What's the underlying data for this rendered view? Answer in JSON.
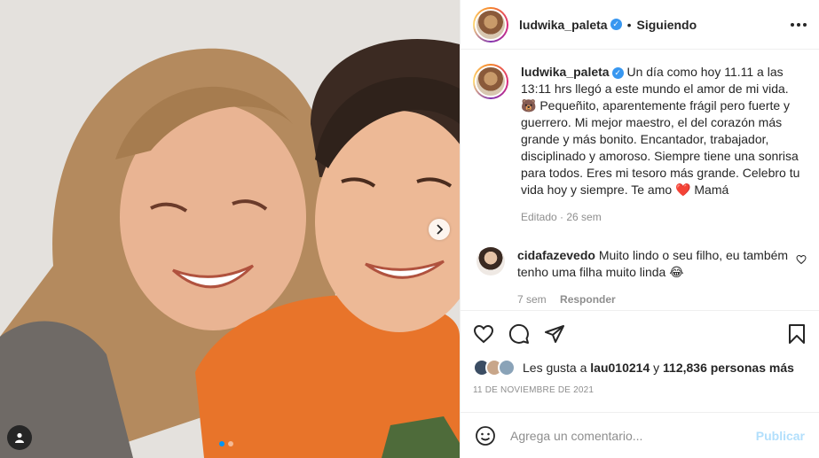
{
  "post": {
    "username": "ludwika_paleta",
    "following_label": "Siguiendo",
    "separator": "•"
  },
  "caption": {
    "username": "ludwika_paleta",
    "text": "Un día como hoy 11.11 a las 13:11 hrs llegó a este mundo el amor de mi vida. 🐻 Pequeñito, aparentemente frágil pero fuerte y guerrero. Mi mejor maestro, el del corazón más grande y más bonito. Encantador, trabajador, disciplinado y amoroso. Siempre tiene una sonrisa para todos. Eres mi tesoro más grande. Celebro tu vida hoy y siempre. Te amo ❤️ Mamá",
    "meta": "Editado · 26 sem"
  },
  "comment": {
    "username": "cidafazevedo",
    "text": "Muito lindo o seu filho, eu também tenho uma filha muito linda 😂",
    "time": "7 sem",
    "reply_label": "Responder"
  },
  "likes": {
    "prefix": "Les gusta a",
    "user": "lau010214",
    "joiner": "y",
    "count_text": "112,836 personas más"
  },
  "date": "11 de noviembre de 2021",
  "add_comment": {
    "placeholder": "Agrega un comentario...",
    "publish_label": "Publicar"
  },
  "carousel": {
    "current": 1,
    "total": 2
  },
  "colors": {
    "accent": "#0095f6",
    "verified": "#3897f0",
    "like_heart": "#ed4956",
    "publish_disabled": "#b2dffc"
  },
  "icons": [
    "more-icon",
    "heart-icon",
    "comment-icon",
    "share-icon",
    "bookmark-icon",
    "emoji-icon",
    "user-tag-icon",
    "chevron-right-icon",
    "verified-icon"
  ]
}
